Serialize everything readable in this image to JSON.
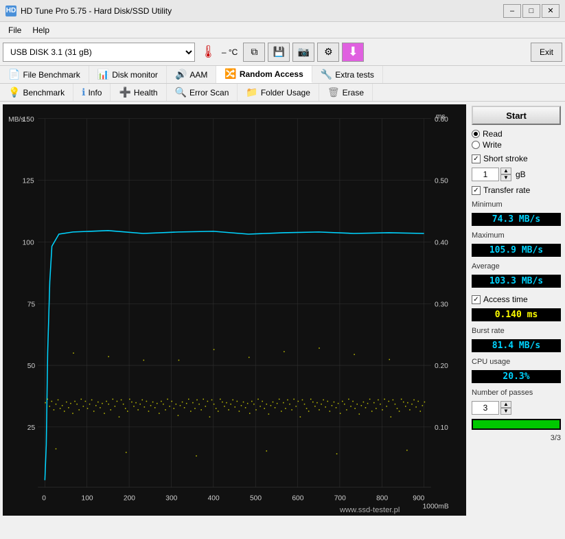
{
  "titleBar": {
    "icon": "HD",
    "title": "HD Tune Pro 5.75 - Hard Disk/SSD Utility",
    "minimizeBtn": "–",
    "maximizeBtn": "□",
    "closeBtn": "✕"
  },
  "menuBar": {
    "items": [
      "File",
      "Help"
    ]
  },
  "toolbar": {
    "diskLabel": "USB DISK 3.1 (31 gB)",
    "tempLabel": "– °C",
    "exitLabel": "Exit"
  },
  "tabs": {
    "row1": [
      {
        "id": "file-benchmark",
        "label": "File Benchmark",
        "icon": "📄"
      },
      {
        "id": "disk-monitor",
        "label": "Disk monitor",
        "icon": "📊"
      },
      {
        "id": "aam",
        "label": "AAM",
        "icon": "🔊"
      },
      {
        "id": "random-access",
        "label": "Random Access",
        "icon": "🔀",
        "active": true
      },
      {
        "id": "extra-tests",
        "label": "Extra tests",
        "icon": "🔧"
      }
    ],
    "row2": [
      {
        "id": "benchmark",
        "label": "Benchmark",
        "icon": "⚡"
      },
      {
        "id": "info",
        "label": "Info",
        "icon": "ℹ"
      },
      {
        "id": "health",
        "label": "Health",
        "icon": "➕"
      },
      {
        "id": "error-scan",
        "label": "Error Scan",
        "icon": "🔍"
      },
      {
        "id": "folder-usage",
        "label": "Folder Usage",
        "icon": "📁"
      },
      {
        "id": "erase",
        "label": "Erase",
        "icon": "🗑"
      }
    ]
  },
  "chart": {
    "yAxisLeft": {
      "label": "MB/s",
      "max": 150,
      "marks": [
        25,
        50,
        75,
        100,
        125,
        150
      ]
    },
    "yAxisRight": {
      "label": "ms",
      "max": 0.6,
      "marks": [
        0.1,
        0.2,
        0.3,
        0.4,
        0.5,
        0.6
      ]
    },
    "xAxis": {
      "max": 1000,
      "marks": [
        0,
        100,
        200,
        300,
        400,
        500,
        600,
        700,
        800,
        900,
        "1000mB"
      ]
    },
    "transferLine": {
      "color": "#00d4ff",
      "avgY": 103.3
    },
    "scatterColor": "#e8e800"
  },
  "controls": {
    "startLabel": "Start",
    "readLabel": "Read",
    "writeLabel": "Write",
    "shortStrokeLabel": "Short stroke",
    "shortStrokeValue": "1",
    "shortStrokeUnit": "gB",
    "transferRateLabel": "Transfer rate",
    "minimumLabel": "Minimum",
    "minimumValue": "74.3 MB/s",
    "maximumLabel": "Maximum",
    "maximumValue": "105.9 MB/s",
    "averageLabel": "Average",
    "averageValue": "103.3 MB/s",
    "accessTimeLabel": "Access time",
    "accessTimeValue": "0.140 ms",
    "burstRateLabel": "Burst rate",
    "burstRateValue": "81.4 MB/s",
    "cpuUsageLabel": "CPU usage",
    "cpuUsageValue": "20.3%",
    "numberOfPassesLabel": "Number of passes",
    "numberOfPassesValue": "3",
    "progressLabel": "3/3"
  },
  "watermark": "www.ssd-tester.pl"
}
